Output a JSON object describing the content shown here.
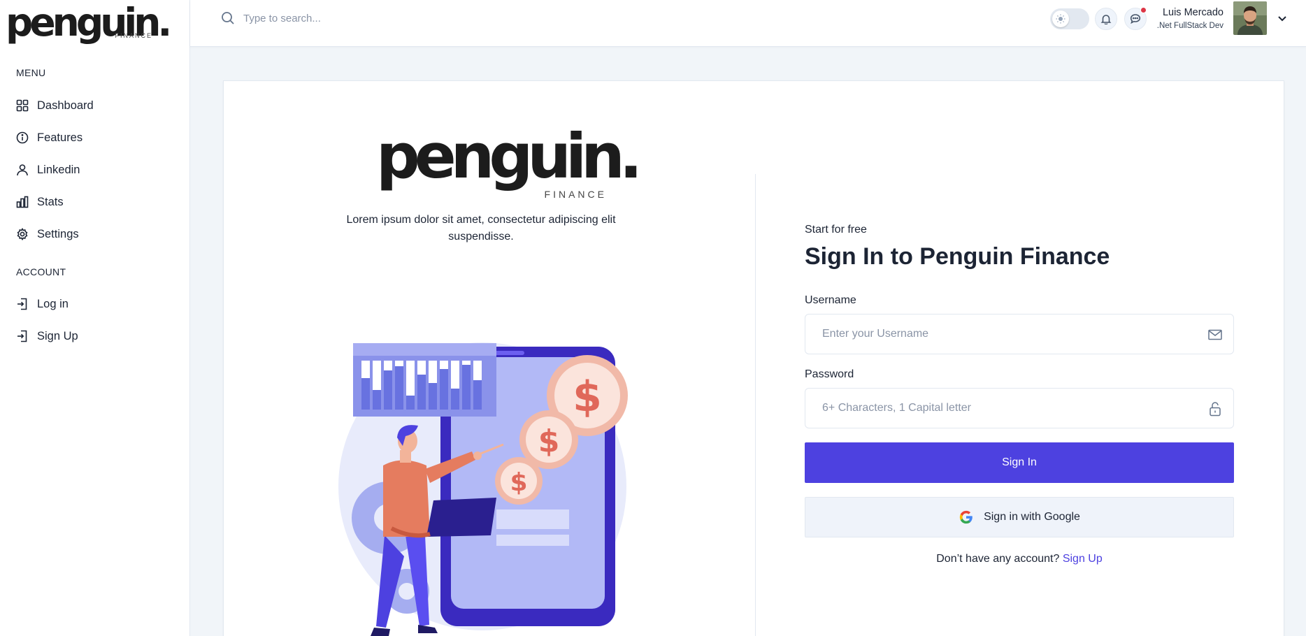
{
  "brand": {
    "name": "penguin.",
    "sub": "FINANCE"
  },
  "sidebar": {
    "menu_title": "MENU",
    "menu_items": [
      {
        "label": "Dashboard",
        "icon": "grid-icon"
      },
      {
        "label": "Features",
        "icon": "info-icon"
      },
      {
        "label": "Linkedin",
        "icon": "user-icon"
      },
      {
        "label": "Stats",
        "icon": "bar-chart-icon"
      },
      {
        "label": "Settings",
        "icon": "gear-icon"
      }
    ],
    "account_title": "ACCOUNT",
    "account_items": [
      {
        "label": "Log in",
        "icon": "login-icon"
      },
      {
        "label": "Sign Up",
        "icon": "signup-icon"
      }
    ]
  },
  "header": {
    "search_placeholder": "Type to search...",
    "user": {
      "name": "Luis Mercado",
      "role": ".Net FullStack Dev"
    }
  },
  "main": {
    "tagline": "Lorem ipsum dolor sit amet, consectetur adipiscing elit suspendisse.",
    "form": {
      "kicker": "Start for free",
      "title": "Sign In to Penguin Finance",
      "username_label": "Username",
      "username_placeholder": "Enter your Username",
      "password_label": "Password",
      "password_placeholder": "6+ Characters, 1 Capital letter",
      "signin_label": "Sign In",
      "google_label": "Sign in with Google",
      "no_account_text": "Don’t have any account?",
      "signup_link": "Sign Up"
    }
  },
  "colors": {
    "primary": "#4d41e0",
    "notification": "#dc3545",
    "illustration_coin": "#e8705a"
  }
}
